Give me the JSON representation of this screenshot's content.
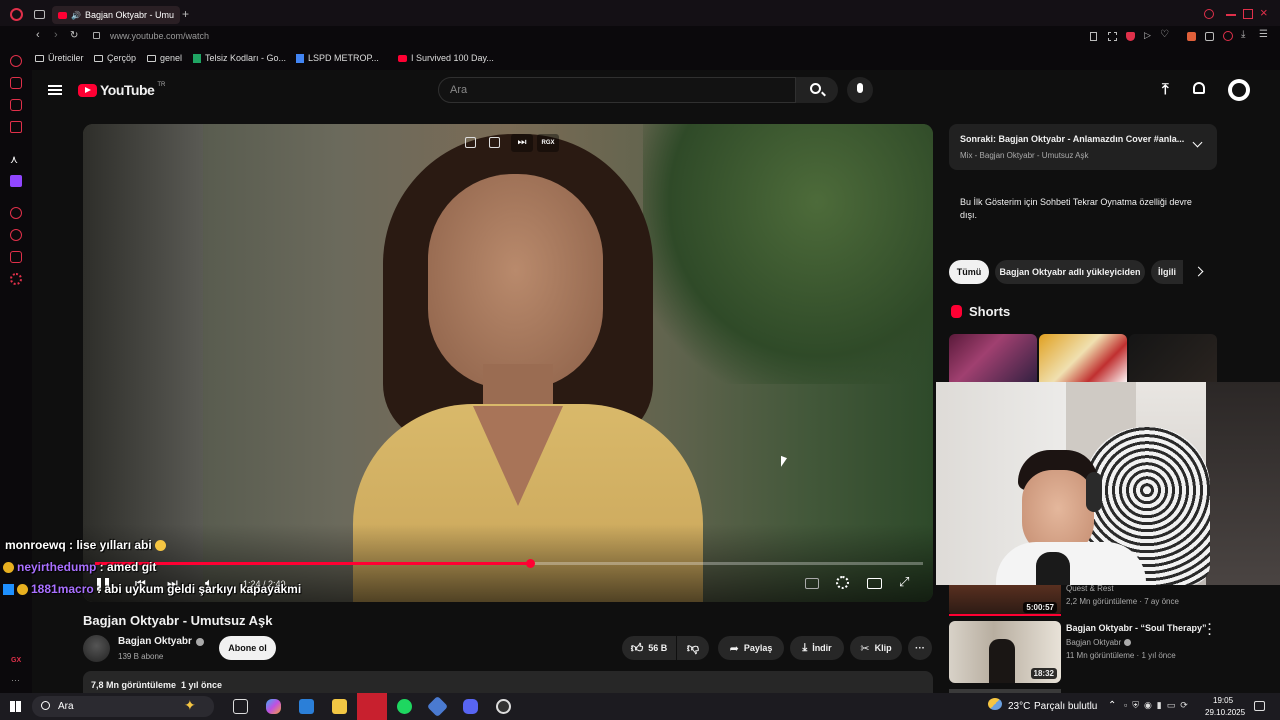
{
  "browser": {
    "tab_title": "Bagjan Oktyabr - Umu",
    "url": "www.youtube.com/watch",
    "bookmarks": [
      "Üreticiler",
      "Çerçöp",
      "genel",
      "Telsiz Kodları - Go...",
      "LSPD METROP...",
      "I Survived 100 Day..."
    ],
    "sidebar_label": "GX"
  },
  "youtube": {
    "logo_text": "YouTube",
    "region": "TR",
    "search_placeholder": "Ara"
  },
  "player": {
    "time": "1:24 / 2:40",
    "progress": 0.525,
    "overlay_label": "RGX"
  },
  "video_info": {
    "title": "Bagjan Oktyabr - Umutsuz Aşk",
    "channel": "Bagjan Oktyabr",
    "subscribers": "139 B abone",
    "subscribe_label": "Abone ol",
    "likes": "56 B",
    "share_label": "Paylaş",
    "download_label": "İndir",
    "clip_label": "Klip",
    "views_line": "7,8 Mn görüntüleme  1 yıl önce"
  },
  "sidebar": {
    "next_title": "Sonraki: Bagjan Oktyabr - Anlamazdın Cover #anla...",
    "next_subtitle": "Mix - Bagjan Oktyabr - Umutsuz Aşk",
    "chat_disabled": "Bu İlk Gösterim için Sohbeti Tekrar Oynatma özelliği devre dışı.",
    "chips": [
      "Tümü",
      "Bagjan Oktyabr adlı yükleyiciden",
      "İlgili"
    ],
    "shorts_label": "Shorts",
    "videos": [
      {
        "title": "",
        "channel": "Quest & Rest",
        "meta": "2,2 Mn görüntüleme · 7 ay önce",
        "duration": "5:00:57"
      },
      {
        "title": "Bagjan Oktyabr - “Soul Therapy”",
        "channel": "Bagjan Oktyabr",
        "meta": "11 Mn görüntüleme · 1 yıl önce",
        "duration": "18:32"
      }
    ]
  },
  "chat": [
    {
      "user": "monroewq",
      "msg": " : lise yılları abi",
      "color": "#ffffff"
    },
    {
      "user": "neyirthedump",
      "msg": " : amed git",
      "color": "#a970ff"
    },
    {
      "user": "1881macro",
      "msg": " : abi uykum geldi şarkıyı kapayakmi",
      "color": "#a970ff"
    }
  ],
  "taskbar": {
    "search": "Ara",
    "weather_temp": "23°C",
    "weather_text": "Parçalı bulutlu",
    "time": "19:05",
    "date": "29.10.2025"
  },
  "colors": {
    "accent_red": "#ff0033",
    "opera_red": "#e0304a"
  }
}
